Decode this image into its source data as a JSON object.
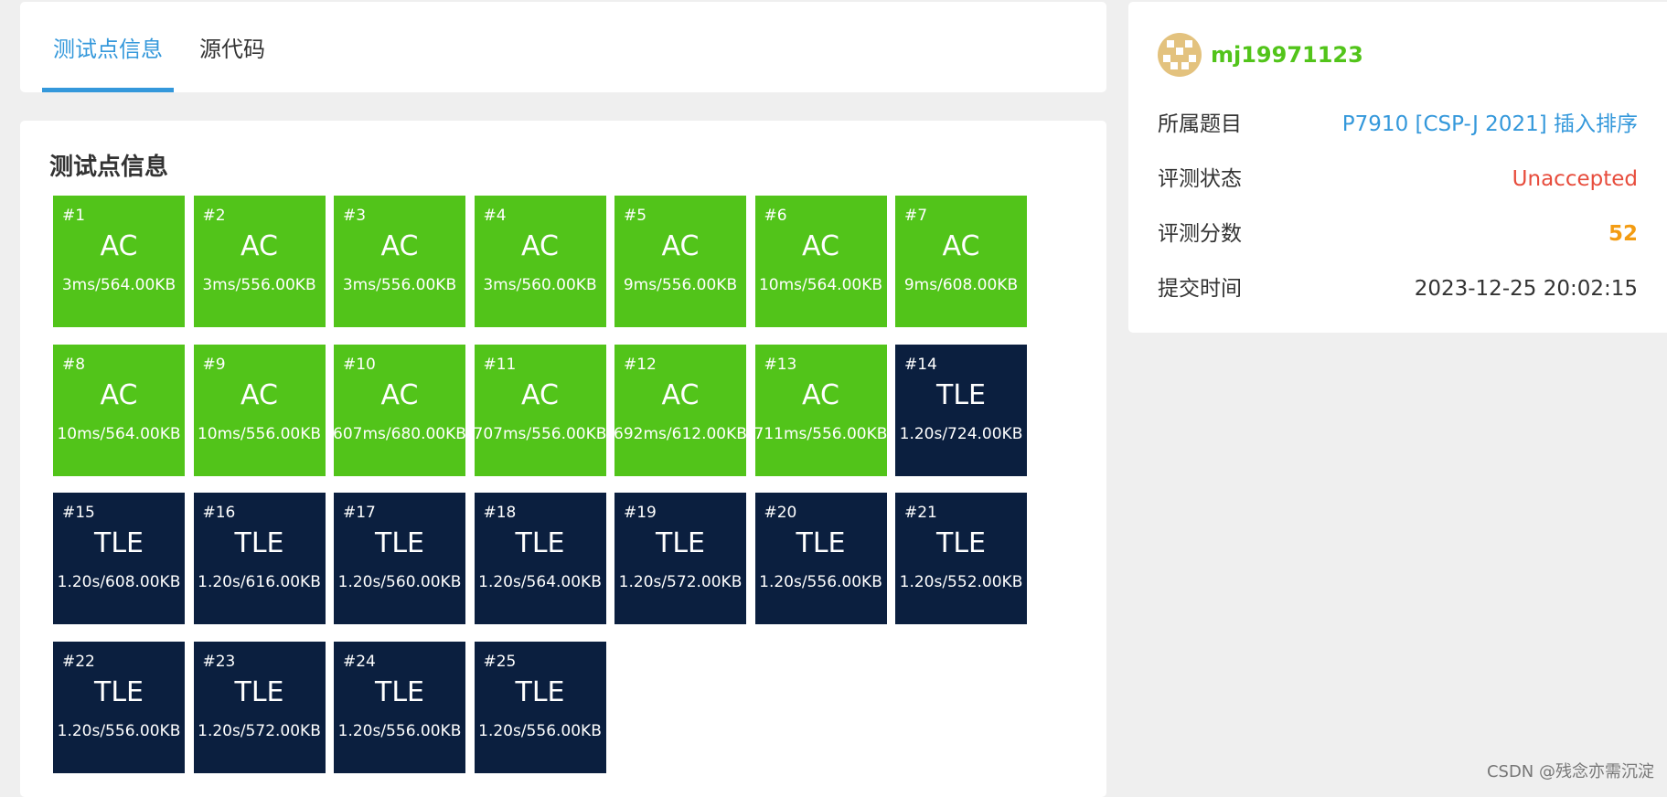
{
  "tabs": [
    {
      "label": "测试点信息",
      "active": true
    },
    {
      "label": "源代码",
      "active": false
    }
  ],
  "tests_title": "测试点信息",
  "test_cases": [
    {
      "num": "#1",
      "result": "AC",
      "stat": "3ms/564.00KB"
    },
    {
      "num": "#2",
      "result": "AC",
      "stat": "3ms/556.00KB"
    },
    {
      "num": "#3",
      "result": "AC",
      "stat": "3ms/556.00KB"
    },
    {
      "num": "#4",
      "result": "AC",
      "stat": "3ms/560.00KB"
    },
    {
      "num": "#5",
      "result": "AC",
      "stat": "9ms/556.00KB"
    },
    {
      "num": "#6",
      "result": "AC",
      "stat": "10ms/564.00KB"
    },
    {
      "num": "#7",
      "result": "AC",
      "stat": "9ms/608.00KB"
    },
    {
      "num": "#8",
      "result": "AC",
      "stat": "10ms/564.00KB"
    },
    {
      "num": "#9",
      "result": "AC",
      "stat": "10ms/556.00KB"
    },
    {
      "num": "#10",
      "result": "AC",
      "stat": "607ms/680.00KB"
    },
    {
      "num": "#11",
      "result": "AC",
      "stat": "707ms/556.00KB"
    },
    {
      "num": "#12",
      "result": "AC",
      "stat": "692ms/612.00KB"
    },
    {
      "num": "#13",
      "result": "AC",
      "stat": "711ms/556.00KB"
    },
    {
      "num": "#14",
      "result": "TLE",
      "stat": "1.20s/724.00KB"
    },
    {
      "num": "#15",
      "result": "TLE",
      "stat": "1.20s/608.00KB"
    },
    {
      "num": "#16",
      "result": "TLE",
      "stat": "1.20s/616.00KB"
    },
    {
      "num": "#17",
      "result": "TLE",
      "stat": "1.20s/560.00KB"
    },
    {
      "num": "#18",
      "result": "TLE",
      "stat": "1.20s/564.00KB"
    },
    {
      "num": "#19",
      "result": "TLE",
      "stat": "1.20s/572.00KB"
    },
    {
      "num": "#20",
      "result": "TLE",
      "stat": "1.20s/556.00KB"
    },
    {
      "num": "#21",
      "result": "TLE",
      "stat": "1.20s/552.00KB"
    },
    {
      "num": "#22",
      "result": "TLE",
      "stat": "1.20s/556.00KB"
    },
    {
      "num": "#23",
      "result": "TLE",
      "stat": "1.20s/572.00KB"
    },
    {
      "num": "#24",
      "result": "TLE",
      "stat": "1.20s/556.00KB"
    },
    {
      "num": "#25",
      "result": "TLE",
      "stat": "1.20s/556.00KB"
    }
  ],
  "result_colors": {
    "AC": "#52c41a",
    "TLE": "#0b1f3f"
  },
  "info": {
    "username": "mj19971123",
    "avatar_icon": "identicon-avatar-icon",
    "problem_label": "所属题目",
    "problem_value": "P7910 [CSP-J 2021] 插入排序",
    "status_label": "评测状态",
    "status_value": "Unaccepted",
    "score_label": "评测分数",
    "score_value": "52",
    "time_label": "提交时间",
    "time_value": "2023-12-25 20:02:15"
  },
  "watermark": "CSDN @残念亦需沉淀"
}
